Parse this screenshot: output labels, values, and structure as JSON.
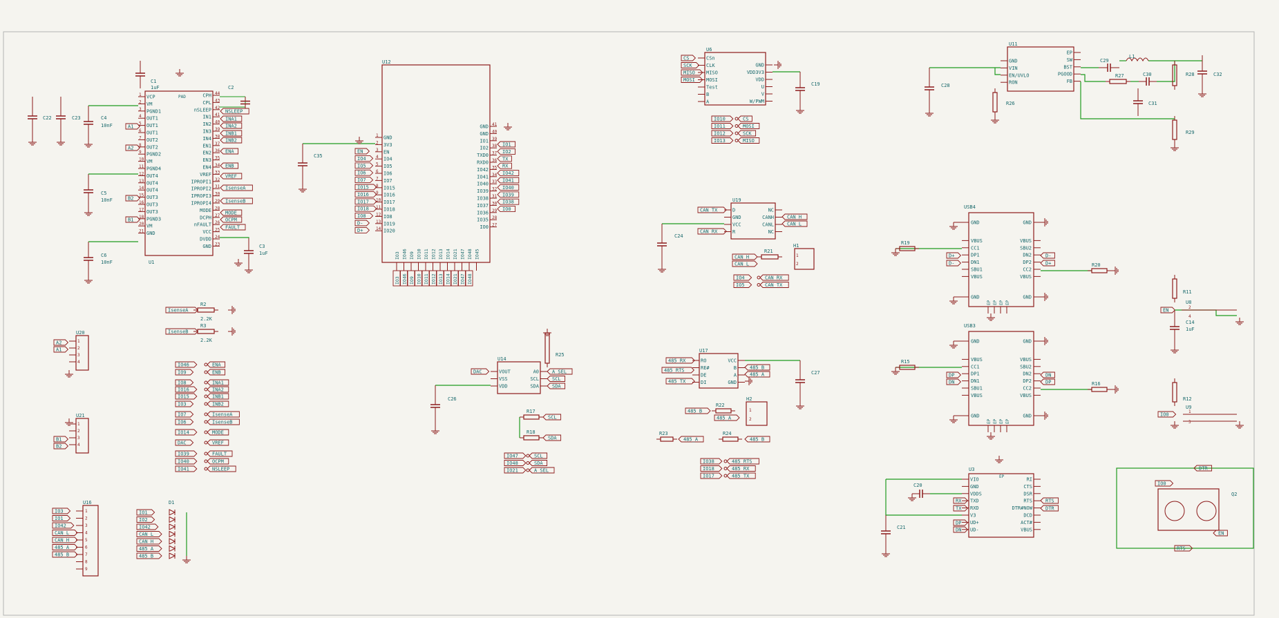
{
  "colors": {
    "background": "#f5f4ef",
    "symbol": "#8c1a1a",
    "symbol_fill": "#f5f4ef",
    "wire": "#1e9b1e",
    "text": "#17686b",
    "sheet_border": "#b3b3b3"
  },
  "parts": {
    "u1": {
      "ref": "U1",
      "pad": "PAD",
      "left": [
        "VCP",
        "VM",
        "PGND1",
        "OUT1",
        "OUT1",
        "OUT1",
        "OUT2",
        "OUT2",
        "PGND2",
        "VM",
        "PGND4",
        "OUT4",
        "OUT4",
        "OUT4",
        "OUT3",
        "OUT3",
        "OUT3",
        "PGND3",
        "VM",
        "GND"
      ],
      "left_nums": [
        "1",
        "2",
        "3",
        "4",
        "5",
        "6",
        "7",
        "8",
        "9",
        "10",
        "11",
        "12",
        "13",
        "14",
        "15",
        "16",
        "17",
        "18",
        "20",
        "21",
        "22"
      ],
      "right": [
        "CPH",
        "CPL",
        "nSLEEP",
        "IN1",
        "IN2",
        "IN3",
        "IN4",
        "EN1",
        "EN2",
        "EN3",
        "EN4",
        "VREF",
        "IPROPI1",
        "IPROPI2",
        "IPROPI3",
        "IPROPI4",
        "MODE",
        "DCPH",
        "nFAULT",
        "VCC",
        "DVDD",
        "GND"
      ],
      "right_nums": [
        "44",
        "43",
        "42",
        "41",
        "40",
        "39",
        "38",
        "37",
        "36",
        "35",
        "34",
        "33",
        "32",
        "31",
        "30",
        "29",
        "28",
        "27",
        "26",
        "25",
        "24",
        "23"
      ]
    },
    "u1_labels": {
      "a1": "A1",
      "a2": "A2",
      "b2": "B2",
      "b1": "B1"
    },
    "u1_net_labels": [
      "NSLEEP",
      "INA1",
      "INA2",
      "INB1",
      "INB2",
      "ENA",
      "ENB",
      "VREF",
      "IsenseA",
      "IsenseB",
      "MODE",
      "OCPM",
      "FAULT"
    ],
    "caps_left": [
      {
        "ref": "C1",
        "val": "1uF"
      },
      {
        "ref": "C2",
        "val": ""
      },
      {
        "ref": "C22",
        "val": ""
      },
      {
        "ref": "C23",
        "val": ""
      },
      {
        "ref": "C4",
        "val": "10nF"
      },
      {
        "ref": "C5",
        "val": "10nF"
      },
      {
        "ref": "C6",
        "val": "10nF"
      },
      {
        "ref": "C3",
        "val": "1uF"
      }
    ],
    "u12": {
      "ref": "U12",
      "left": [
        "GND",
        "3V3",
        "EN",
        "IO4",
        "IO5",
        "IO6",
        "IO7",
        "IO15",
        "IO16",
        "IO17",
        "IO18",
        "IO8",
        "IO19",
        "IO20"
      ],
      "left_nums": [
        "1",
        "2",
        "3",
        "4",
        "5",
        "6",
        "7",
        "8",
        "9",
        "10",
        "11",
        "12",
        "13",
        "14"
      ],
      "right": [
        "GND",
        "GND",
        "IO1",
        "IO2",
        "TXD0",
        "RXD0",
        "IO42",
        "IO41",
        "IO40",
        "IO39",
        "IO38",
        "IO37",
        "IO36",
        "IO35",
        "IO0"
      ],
      "right_nums": [
        "41",
        "40",
        "39",
        "38",
        "37",
        "36",
        "35",
        "34",
        "33",
        "32",
        "31",
        "30",
        "29",
        "28",
        "27"
      ],
      "bottom": [
        "IO3",
        "IO46",
        "IO9",
        "IO10",
        "IO11",
        "IO12",
        "IO13",
        "IO14",
        "IO21",
        "IO47",
        "IO48",
        "IO45"
      ],
      "c35": "C35",
      "left_labels": [
        "EN",
        "IO4",
        "IO5",
        "IO6",
        "IO7",
        "IO15",
        "IO16",
        "IO17",
        "IO18",
        "IO8",
        "D-",
        "D+"
      ],
      "right_labels": [
        "IO1",
        "IO2",
        "TX",
        "RX",
        "IO42",
        "IO41",
        "IO40",
        "IO39",
        "IO38",
        "IO0"
      ],
      "bottom_labels": [
        "IO3",
        "IO46",
        "IO9",
        "IO10",
        "IO11",
        "IO12",
        "IO13",
        "IO14",
        "IO21",
        "IO47",
        "IO48"
      ]
    },
    "u6": {
      "ref": "U6",
      "left": [
        "CSn",
        "CLK",
        "MISO",
        "MOSI",
        "Test",
        "B",
        "A"
      ],
      "right": [
        "GND",
        "VDD3V3",
        "VDD",
        "U",
        "V",
        "W/PWM"
      ],
      "left_labels": [
        "CS",
        "SCK",
        "MISO",
        "MOSI"
      ],
      "c19": "C19",
      "map": [
        [
          "IO10",
          "CS"
        ],
        [
          "IO11",
          "MOSI"
        ],
        [
          "IO12",
          "SCK"
        ],
        [
          "IO13",
          "MISO"
        ]
      ]
    },
    "u11": {
      "ref": "U11",
      "left": [
        "GND",
        "VIN",
        "EN/UVLO",
        "RON"
      ],
      "right": [
        "EP",
        "SW",
        "BST",
        "PGOOD",
        "FB"
      ],
      "c28": "C28",
      "r26": "R26",
      "c29": "C29",
      "l1": "L1",
      "r27": "R27",
      "c30": "C30",
      "c31": "C31",
      "r28": "R28",
      "c32": "C32",
      "r29": "R29"
    },
    "u19": {
      "ref": "U19",
      "left": [
        "D",
        "GND",
        "VCC",
        "R"
      ],
      "right": [
        "NC",
        "CANH",
        "CANL",
        "NC"
      ],
      "labels_l": [
        "CAN_TX",
        "CAN_RX"
      ],
      "labels_r": [
        "CAN_H",
        "CAN_L"
      ],
      "c24": "C24",
      "r21": "R21",
      "h1": "H1",
      "h1_labels": [
        "CAN_H",
        "CAN_L"
      ],
      "map": [
        [
          "IO4",
          "CAN_RX"
        ],
        [
          "IO5",
          "CAN_TX"
        ]
      ]
    },
    "usb4": {
      "ref": "USB4",
      "left": [
        "GND",
        "VBUS",
        "CC1",
        "DP1",
        "DN1",
        "SBU1",
        "VBUS",
        "GND"
      ],
      "right": [
        "GND",
        "VBUS",
        "SBU2",
        "DN2",
        "DP2",
        "CC2",
        "VBUS",
        "GND"
      ],
      "r19": "R19",
      "r20": "R20",
      "labels_l": [
        "D+",
        "D-"
      ],
      "labels_r": [
        "D-",
        "D+"
      ],
      "bottom": [
        "EP",
        "EP",
        "EP",
        "EP"
      ]
    },
    "usb3": {
      "ref": "USB3",
      "left": [
        "GND",
        "VBUS",
        "CC1",
        "DP1",
        "DN1",
        "SBU1",
        "VBUS",
        "GND"
      ],
      "right": [
        "GND",
        "VBUS",
        "SBU2",
        "DN2",
        "DP2",
        "CC2",
        "VBUS",
        "GND"
      ],
      "r15": "R15",
      "r16": "R16",
      "labels_l": [
        "DP",
        "DN"
      ],
      "labels_r": [
        "DN",
        "DP"
      ],
      "bottom": [
        "EP",
        "EP",
        "EP",
        "EP"
      ]
    },
    "u3": {
      "ref": "U3",
      "top": "EP",
      "left": [
        "VIO",
        "GND",
        "VDDS",
        "TXD",
        "RXD",
        "V3",
        "UD+",
        "UD-"
      ],
      "right": [
        "RI",
        "CTS",
        "DSR",
        "RTS",
        "DTR#NOW",
        "DCD",
        "ACT#",
        "VBUS"
      ],
      "labels_l": [
        "RX",
        "TX",
        "DP",
        "DN"
      ],
      "labels_r": [
        "RTS",
        "DTR"
      ],
      "c20": "C20",
      "c21": "C21"
    },
    "u8": {
      "ref": "U8",
      "r11": "R11",
      "c14": "C14",
      "c14v": "1uF",
      "en": "EN",
      "pins": [
        "2",
        "4",
        "1",
        "3"
      ]
    },
    "u9": {
      "ref": "U9",
      "r12": "R12",
      "io0": "IO0",
      "pins": [
        "1",
        "3",
        "2",
        "4"
      ]
    },
    "q2": {
      "ref": "Q2",
      "labels": [
        "DTR",
        "IO0",
        "EN",
        "RTS"
      ]
    },
    "r2": {
      "ref": "R2",
      "val": "2.2K",
      "label": "IsenseA"
    },
    "r3": {
      "ref": "R3",
      "val": "2.2K",
      "label": "IsenseB"
    },
    "u20": {
      "ref": "U20",
      "labels": [
        "A2",
        "A1"
      ],
      "pins": [
        "1",
        "2",
        "3",
        "4"
      ]
    },
    "u21": {
      "ref": "U21",
      "labels": [
        "B1",
        "B2"
      ],
      "pins": [
        "1",
        "2",
        "3",
        "4"
      ]
    },
    "u16": {
      "ref": "U16",
      "labels": [
        "IO3",
        "IO1",
        "IO42",
        "CAN_L",
        "CAN_H",
        "485_A",
        "485_B"
      ],
      "pins": [
        "1",
        "2",
        "3",
        "4",
        "5",
        "6",
        "7",
        "8",
        "9"
      ]
    },
    "d1": {
      "ref": "D1",
      "labels": [
        "IO1",
        "IO2",
        "IO42",
        "CAN_L",
        "CAN_H",
        "485_A",
        "485_B"
      ]
    },
    "pinmap": [
      [
        "IO46",
        "ENA"
      ],
      [
        "IO9",
        "ENB"
      ],
      [
        "IO8",
        "INA1"
      ],
      [
        "IO16",
        "INA2"
      ],
      [
        "IO15",
        "INB1"
      ],
      [
        "IO3",
        "INB2"
      ],
      [
        "IO7",
        "IsenseA"
      ],
      [
        "IO6",
        "IsenseB"
      ],
      [
        "IO14",
        "MODE"
      ],
      [
        "DAC",
        "VREF"
      ],
      [
        "IO39",
        "FAULT"
      ],
      [
        "IO40",
        "OCPM"
      ],
      [
        "IO41",
        "NSLEEP"
      ]
    ],
    "u14": {
      "ref": "U14",
      "left": [
        "VOUT",
        "VSS",
        "VDD"
      ],
      "right": [
        "A0",
        "SCL",
        "SDA"
      ],
      "dac": "DAC",
      "labels_r": [
        "A_SEL",
        "SCL",
        "SDA"
      ],
      "c26": "C26",
      "r25": "R25",
      "r17": "R17",
      "r18": "R18",
      "r_labels": [
        "SCL",
        "SDA"
      ],
      "map": [
        [
          "IO47",
          "SCL"
        ],
        [
          "IO48",
          "SDA"
        ],
        [
          "IO21",
          "A_SEL"
        ]
      ]
    },
    "u17": {
      "ref": "U17",
      "left": [
        "RO",
        "RE#",
        "DE",
        "DI"
      ],
      "right": [
        "VCC",
        "B",
        "A",
        "GND"
      ],
      "labels_l": [
        "485_RX",
        "485_RTS",
        "485_TX"
      ],
      "labels_r": [
        "485_B",
        "485_A"
      ],
      "c27": "C27",
      "r22": "R22",
      "h2": "H2",
      "h2_labels": [
        "485_B",
        "485_A"
      ],
      "r23": "R23",
      "r23_label": "485_A",
      "r24": "R24",
      "r24_label": "485_B",
      "map": [
        [
          "IO38",
          "485_RTS"
        ],
        [
          "IO18",
          "485_RX"
        ],
        [
          "IO17",
          "485_TX"
        ]
      ]
    }
  }
}
